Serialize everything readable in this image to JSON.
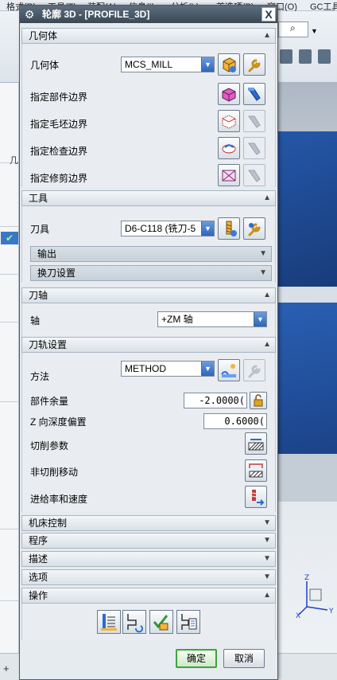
{
  "background_app": {
    "menus": [
      "格式(R)",
      "工具(T)",
      "装配(A)",
      "信息(I)",
      "分析(L)",
      "首选项(P)",
      "窗口(O)",
      "GC工具"
    ],
    "left_panel_label": "几"
  },
  "dialog": {
    "title": "轮廓 3D - [PROFILE_3D]",
    "close_label": "X",
    "geometry": {
      "header": "几何体",
      "geometry_label": "几何体",
      "geometry_value": "MCS_MILL",
      "part_boundary_label": "指定部件边界",
      "blank_boundary_label": "指定毛坯边界",
      "check_boundary_label": "指定检查边界",
      "trim_boundary_label": "指定修剪边界"
    },
    "tool": {
      "header": "工具",
      "tool_label": "刀具",
      "tool_value": "D6-C118 (铣刀-5",
      "output_label": "输出",
      "tool_change_label": "换刀设置"
    },
    "axis": {
      "header": "刀轴",
      "axis_label": "轴",
      "axis_value": "+ZM 轴"
    },
    "path_settings": {
      "header": "刀轨设置",
      "method_label": "方法",
      "method_value": "METHOD",
      "stock_label": "部件余量",
      "stock_value": "-2.0000(",
      "z_offset_label": "Z 向深度偏置",
      "z_offset_value": "0.6000(",
      "cut_params_label": "切削参数",
      "non_cut_label": "非切削移动",
      "feeds_label": "进给率和速度"
    },
    "collapsed_sections": [
      "机床控制",
      "程序",
      "描述",
      "选项"
    ],
    "actions": {
      "header": "操作"
    },
    "ok_label": "确定",
    "cancel_label": "取消"
  },
  "colors": {
    "title_bar": "#3b4855",
    "select_button": "#2f66b8",
    "ok_border": "#3ea33e",
    "viewport_solid": "#1f4a92"
  }
}
